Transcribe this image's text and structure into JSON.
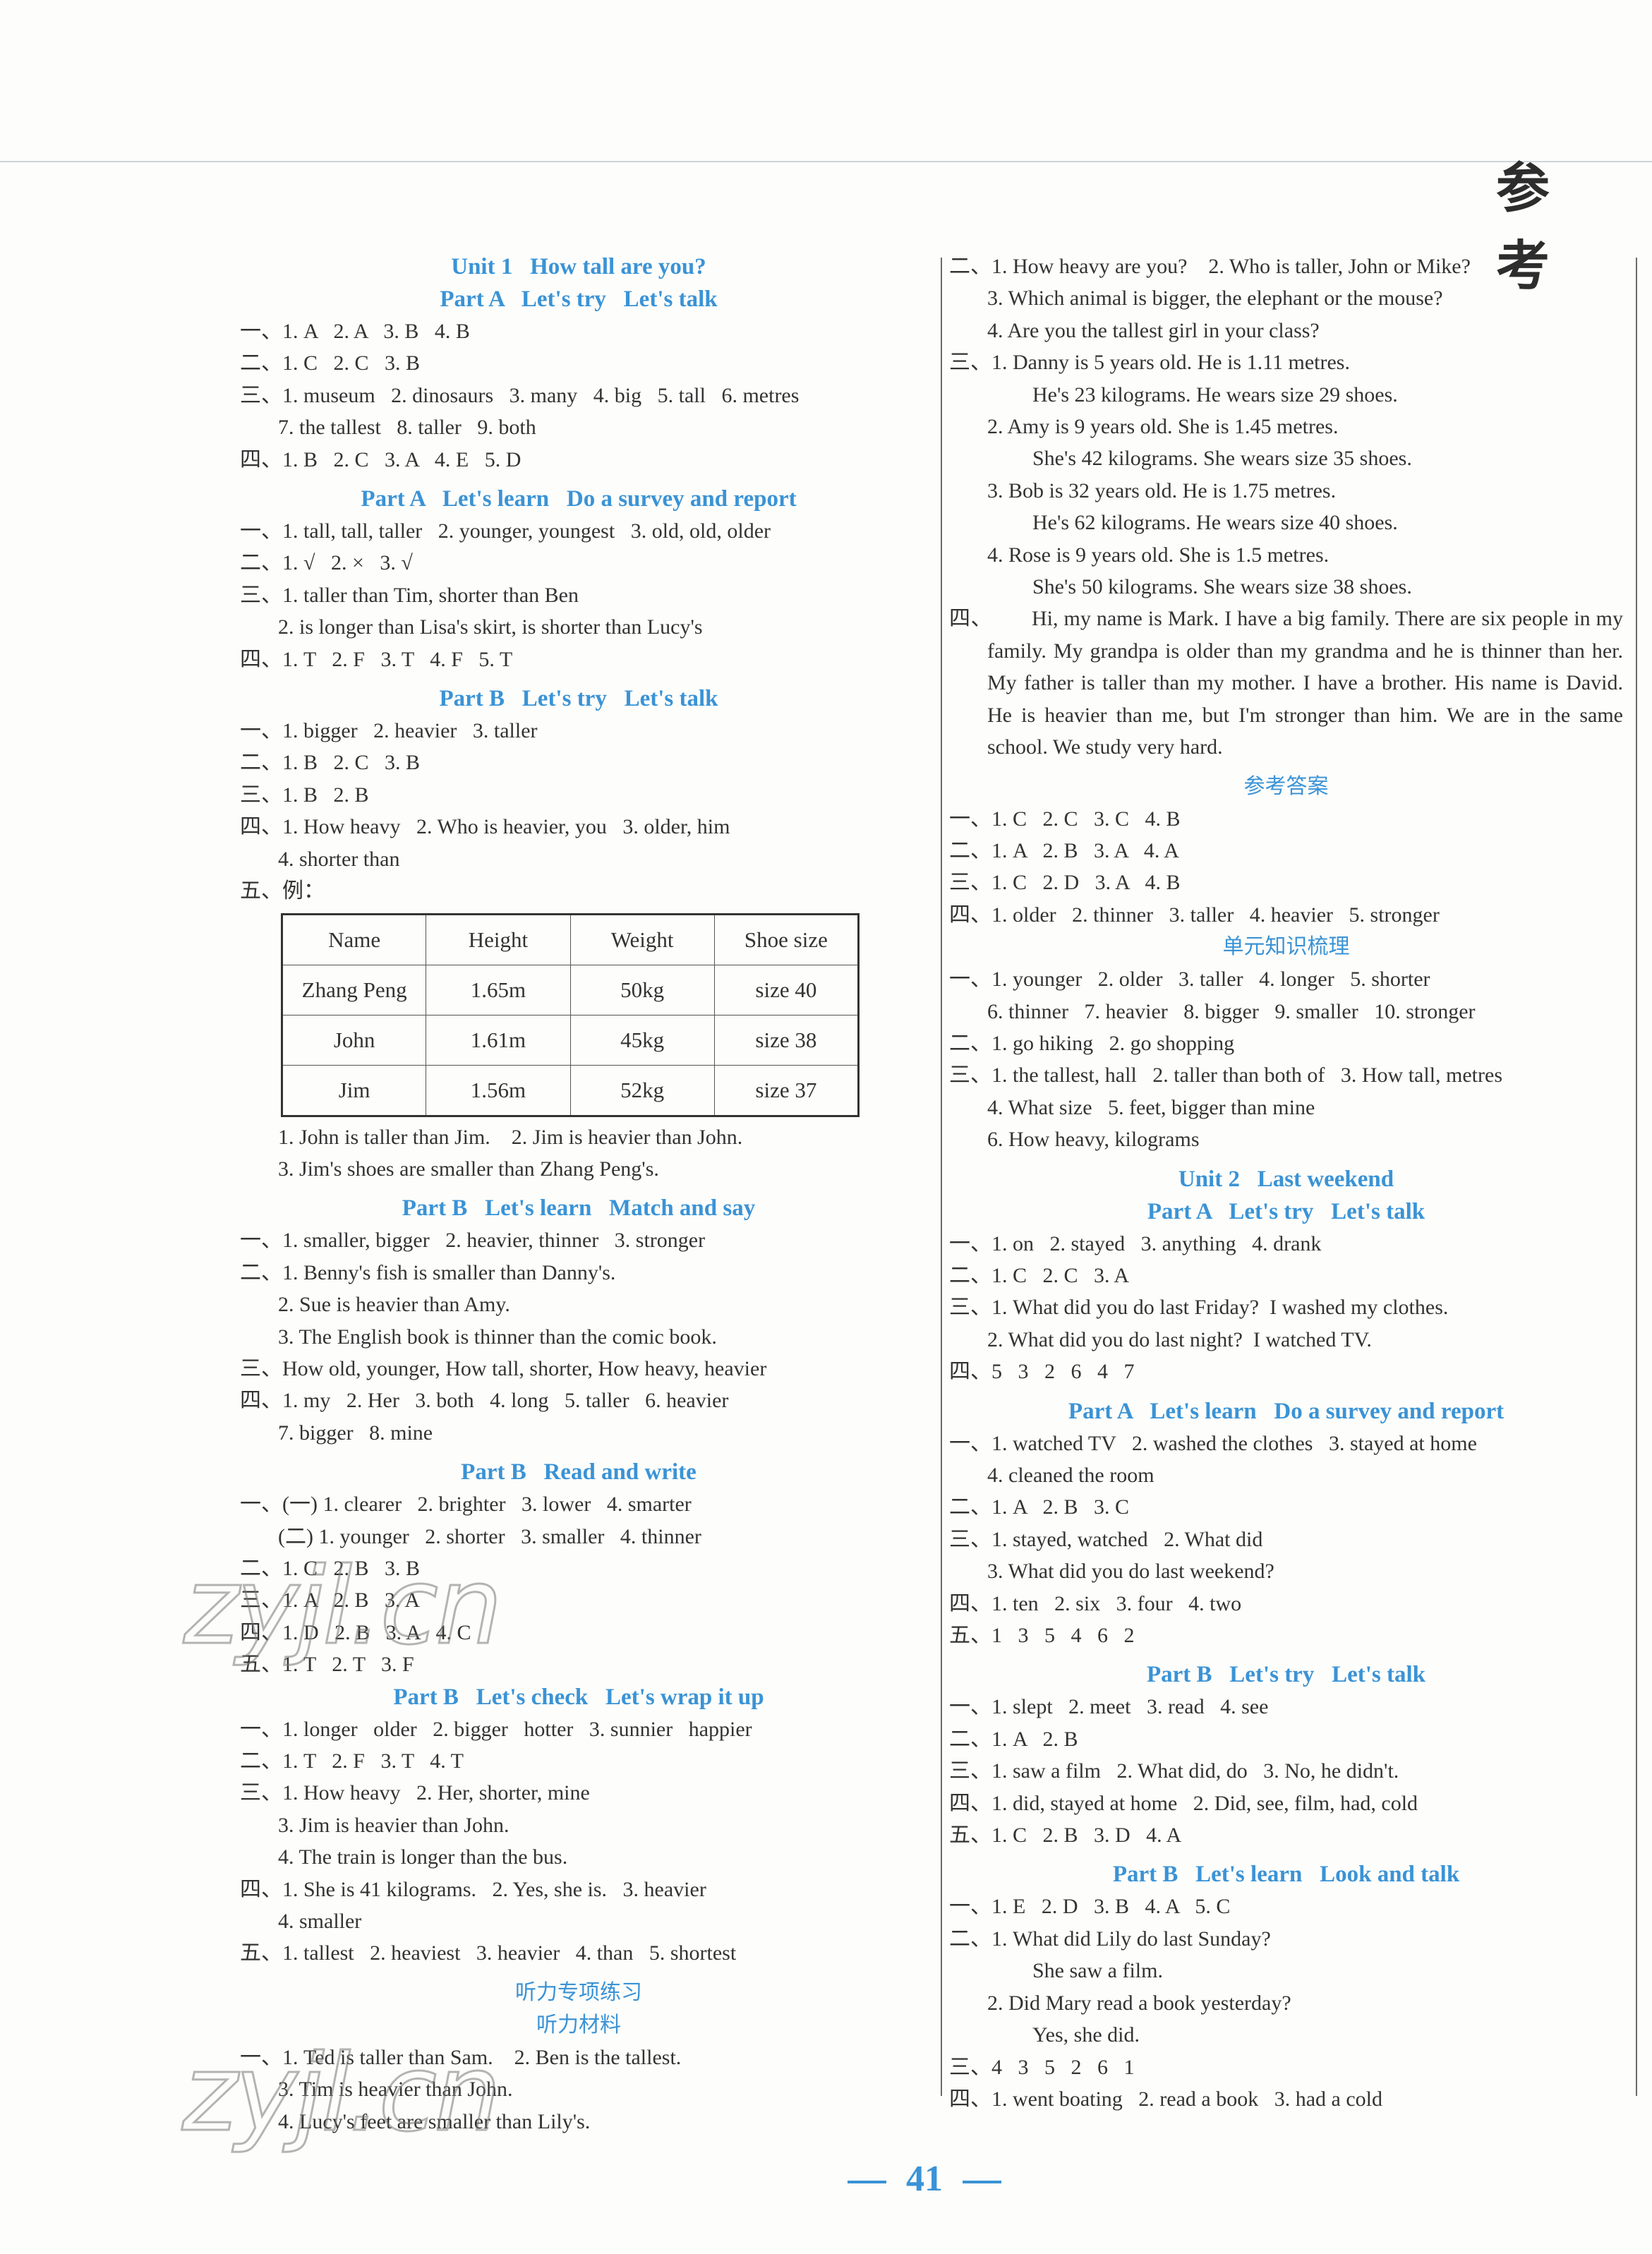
{
  "header": {
    "title": "参 考"
  },
  "page_number": "41",
  "watermark": "zyjl.cn",
  "left": {
    "unit1_title": "Unit 1   How tall are you?",
    "s1": {
      "heading": "Part A   Let's try   Let's talk",
      "lines": [
        "一、1. A   2. A   3. B   4. B",
        "二、1. C   2. C   3. B",
        "三、1. museum   2. dinosaurs   3. many   4. big   5. tall   6. metres",
        "7. the tallest   8. taller   9. both",
        "四、1. B   2. C   3. A   4. E   5. D"
      ]
    },
    "s2": {
      "heading": "Part A   Let's learn   Do a survey and report",
      "lines": [
        "一、1. tall, tall, taller   2. younger, youngest   3. old, old, older",
        "二、1. √   2. ×   3. √",
        "三、1. taller than Tim, shorter than Ben",
        "2. is longer than Lisa's skirt, is shorter than Lucy's",
        "四、1. T   2. F   3. T   4. F   5. T"
      ]
    },
    "s3": {
      "heading": "Part B   Let's try   Let's talk",
      "lines": [
        "一、1. bigger   2. heavier   3. taller",
        "二、1. B   2. C   3. B",
        "三、1. B   2. B",
        "四、1. How heavy   2. Who is heavier, you   3. older, him",
        "4. shorter than",
        "五、例："
      ],
      "table": {
        "headers": [
          "Name",
          "Height",
          "Weight",
          "Shoe size"
        ],
        "rows": [
          [
            "Zhang Peng",
            "1.65m",
            "50kg",
            "size 40"
          ],
          [
            "John",
            "1.61m",
            "45kg",
            "size 38"
          ],
          [
            "Jim",
            "1.56m",
            "52kg",
            "size 37"
          ]
        ]
      },
      "after": [
        "1. John is taller than Jim.    2. Jim is heavier than John.",
        "3. Jim's shoes are smaller than Zhang Peng's."
      ]
    },
    "s4": {
      "heading": "Part B   Let's learn   Match and say",
      "lines": [
        "一、1. smaller, bigger   2. heavier, thinner   3. stronger",
        "二、1. Benny's fish is smaller than Danny's.",
        "2. Sue is heavier than Amy.",
        "3. The English book is thinner than the comic book.",
        "三、How old, younger, How tall, shorter, How heavy, heavier",
        "四、1. my   2. Her   3. both   4. long   5. taller   6. heavier",
        "7. bigger   8. mine"
      ]
    },
    "s5": {
      "heading": "Part B   Read and write",
      "lines": [
        "一、(一) 1. clearer   2. brighter   3. lower   4. smarter",
        "(二) 1. younger   2. shorter   3. smaller   4. thinner",
        "二、1. C   2. B   3. B",
        "三、1. A   2. B   3. A",
        "四、1. D   2. B   3. A   4. C",
        "五、1. T   2. T   3. F"
      ]
    },
    "s6": {
      "heading": "Part B   Let's check   Let's wrap it up",
      "lines": [
        "一、1. longer   older   2. bigger   hotter   3. sunnier   happier",
        "二、1. T   2. F   3. T   4. T",
        "三、1. How heavy   2. Her, shorter, mine",
        "3. Jim is heavier than John.",
        "4. The train is longer than the bus.",
        "四、1. She is 41 kilograms.   2. Yes, she is.   3. heavier",
        "4. smaller",
        "五、1. tallest   2. heaviest   3. heavier   4. than   5. shortest"
      ]
    },
    "s7": {
      "heading": "听力专项练习",
      "subheading": "听力材料",
      "lines": [
        "一、1. Ted is taller than Sam.    2. Ben is the tallest.",
        "3. Tim is heavier than John.",
        "4. Lucy's feet are smaller than Lily's."
      ]
    }
  },
  "right": {
    "r1": {
      "lines": [
        "二、1. How heavy are you?    2. Who is taller, John or Mike?",
        "3. Which animal is bigger, the elephant or the mouse?",
        "4. Are you the tallest girl in your class?",
        "三、1. Danny is 5 years old. He is 1.11 metres.",
        "He's 23 kilograms. He wears size 29 shoes.",
        "2. Amy is 9 years old. She is 1.45 metres.",
        "She's 42 kilograms. She wears size 35 shoes.",
        "3. Bob is 32 years old. He is 1.75 metres.",
        "He's 62 kilograms. He wears size 40 shoes.",
        "4. Rose is 9 years old. She is 1.5 metres.",
        "She's 50 kilograms. She wears size 38 shoes."
      ],
      "paragraph_label": "四、",
      "paragraph": "Hi, my name is Mark. I have a big family. There are six people in my family. My grandpa is older than my grandma and he is thinner than her. My father is taller than my mother. I have a brother. His name is David. He is heavier than me, but I'm stronger than him. We are in the same school. We study very hard."
    },
    "r2": {
      "heading": "参考答案",
      "lines": [
        "一、1. C   2. C   3. C   4. B",
        "二、1. A   2. B   3. A   4. A",
        "三、1. C   2. D   3. A   4. B",
        "四、1. older   2. thinner   3. taller   4. heavier   5. stronger"
      ]
    },
    "r3": {
      "heading": "单元知识梳理",
      "lines": [
        "一、1. younger   2. older   3. taller   4. longer   5. shorter",
        "6. thinner   7. heavier   8. bigger   9. smaller   10. stronger",
        "二、1. go hiking   2. go shopping",
        "三、1. the tallest, hall   2. taller than both of   3. How tall, metres",
        "4. What size   5. feet, bigger than mine",
        "6. How heavy, kilograms"
      ]
    },
    "unit2_title": "Unit 2   Last weekend",
    "r4": {
      "heading": "Part A   Let's try   Let's talk",
      "lines": [
        "一、1. on   2. stayed   3. anything   4. drank",
        "二、1. C   2. C   3. A",
        "三、1. What did you do last Friday?  I washed my clothes.",
        "2. What did you do last night?  I watched TV.",
        "四、5   3   2   6   4   7"
      ]
    },
    "r5": {
      "heading": "Part A   Let's learn   Do a survey and report",
      "lines": [
        "一、1. watched TV   2. washed the clothes   3. stayed at home",
        "4. cleaned the room",
        "二、1. A   2. B   3. C",
        "三、1. stayed, watched   2. What did",
        "3. What did you do last weekend?",
        "四、1. ten   2. six   3. four   4. two",
        "五、1   3   5   4   6   2"
      ]
    },
    "r6": {
      "heading": "Part B   Let's try   Let's talk",
      "lines": [
        "一、1. slept   2. meet   3. read   4. see",
        "二、1. A   2. B",
        "三、1. saw a film   2. What did, do   3. No, he didn't.",
        "四、1. did, stayed at home   2. Did, see, film, had, cold",
        "五、1. C   2. B   3. D   4. A"
      ]
    },
    "r7": {
      "heading": "Part B   Let's learn   Look and talk",
      "lines": [
        "一、1. E   2. D   3. B   4. A   5. C",
        "二、1. What did Lily do last Sunday?",
        "She saw a film.",
        "2. Did Mary read a book yesterday?",
        "Yes, she did.",
        "三、4   3   5   2   6   1",
        "四、1. went boating   2. read a book   3. had a cold"
      ]
    }
  }
}
